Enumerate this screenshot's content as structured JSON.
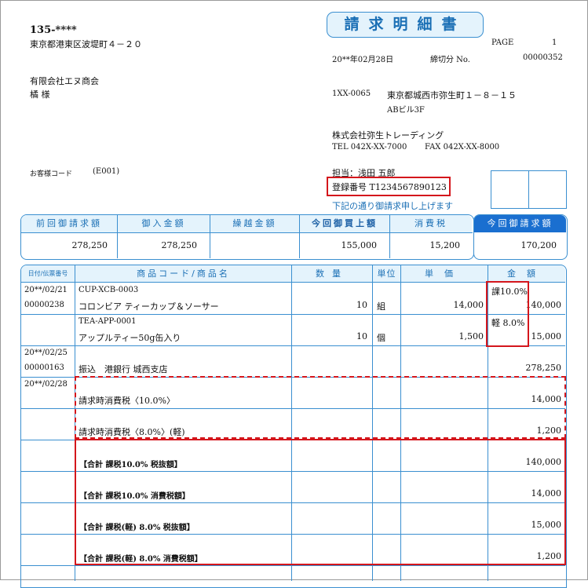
{
  "document": {
    "title": "請求明細書",
    "page_label": "PAGE",
    "page_number": "1",
    "date": "20**年02月28日",
    "closing_label": "締切分 No.",
    "doc_number": "00000352"
  },
  "recipient": {
    "postal": "135-****",
    "address": "東京都港東区波堤町４－２０",
    "company": "有限会社エヌ商会",
    "person": "橘 様",
    "customer_code_label": "お客様コード",
    "customer_code": "(E001)"
  },
  "sender": {
    "postal": "1XX-0065",
    "address1": "東京都城西市弥生町１－８－１５",
    "address2": "ABビル3F",
    "company": "株式会社弥生トレーディング",
    "tel": "TEL 042X-XX-7000",
    "fax": "FAX 042X-XX-8000",
    "person": "担当：浅田 五郎",
    "registration": "登録番号 T1234567890123",
    "note": "下記の通り御請求申し上げます"
  },
  "summary": {
    "headers": [
      "前回御請求額",
      "御入金額",
      "繰越金額",
      "今回御買上額",
      "消費税",
      "今回御請求額"
    ],
    "values": [
      "278,250",
      "278,250",
      "",
      "155,000",
      "15,200",
      "170,200"
    ]
  },
  "table": {
    "headers": [
      "日付/伝票番号",
      "商品コード/商品名",
      "数量",
      "単位",
      "単価",
      "金額"
    ],
    "rows": [
      {
        "date": "20**/02/21",
        "code": "CUP-XCB-0003",
        "tax": "課10.0%"
      },
      {
        "date": "00000238",
        "name": "コロンビア ティーカップ＆ソーサー",
        "qty": "10",
        "unit": "組",
        "price": "14,000",
        "amount": "140,000"
      },
      {
        "code": "TEA-APP-0001",
        "tax": "軽 8.0%"
      },
      {
        "name": "アップルティー50g缶入り",
        "qty": "10",
        "unit": "個",
        "price": "1,500",
        "amount": "15,000"
      },
      {
        "date": "20**/02/25"
      },
      {
        "date": "00000163",
        "name": "振込　港銀行 城西支店",
        "amount": "278,250"
      },
      {
        "date": "20**/02/28"
      },
      {
        "name": "請求時消費税〈10.0%〉",
        "amount": "14,000"
      },
      {
        "name": "請求時消費税〈8.0%〉(軽)",
        "amount": "1,200"
      },
      {
        "name": "【合計 課税10.0% 税抜額】",
        "amount": "140,000"
      },
      {
        "name": "【合計 課税10.0% 消費税額】",
        "amount": "14,000"
      },
      {
        "name": "【合計 課税(軽) 8.0% 税抜額】",
        "amount": "15,000"
      },
      {
        "name": "【合計 課税(軽) 8.0% 消費税額】",
        "amount": "1,200"
      }
    ]
  },
  "colors": {
    "accent": "#3a8fd0",
    "header_fill": "#e4f3fc",
    "highlight": "#d4161c",
    "dark_tab": "#1a6fd0"
  }
}
